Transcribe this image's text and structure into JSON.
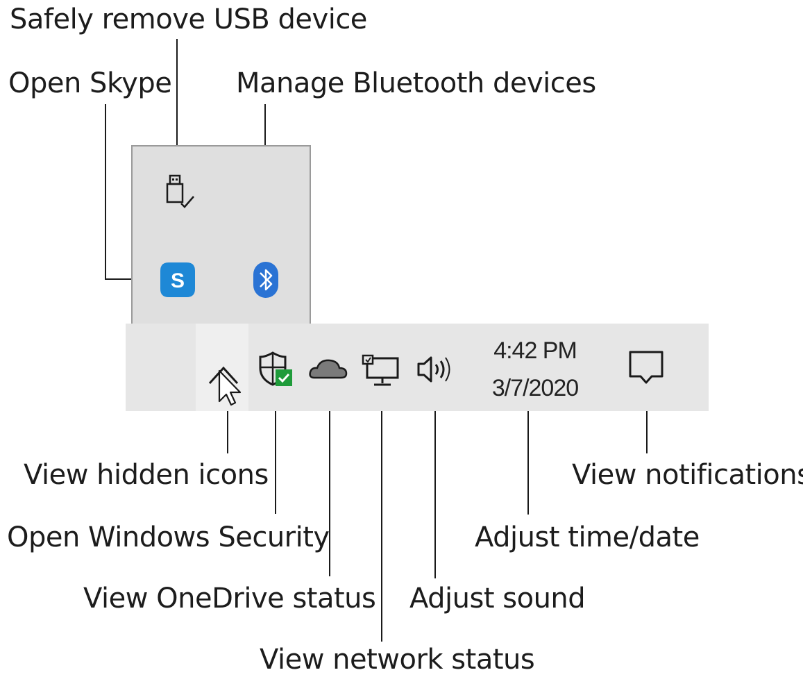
{
  "labels": {
    "safely_remove_usb": "Safely remove USB device",
    "open_skype": "Open Skype",
    "manage_bluetooth": "Manage Bluetooth devices",
    "view_hidden_icons": "View hidden icons",
    "open_windows_security": "Open Windows Security",
    "view_onedrive_status": "View OneDrive status",
    "view_network_status": "View network status",
    "adjust_sound": "Adjust sound",
    "adjust_time_date": "Adjust time/date",
    "view_notifications": "View notifications"
  },
  "taskbar": {
    "time": "4:42 PM",
    "date": "3/7/2020"
  },
  "tray_icons": [
    "chevron-up-icon",
    "windows-security-shield-icon",
    "onedrive-cloud-icon",
    "network-monitor-icon",
    "speaker-volume-icon",
    "notification-speech-bubble-icon"
  ],
  "overflow_icons": [
    "usb-drive-icon",
    "skype-icon",
    "bluetooth-icon"
  ],
  "colors": {
    "skype": "#1e88d6",
    "bluetooth": "#2a73d4",
    "security_check": "#1f9b3a",
    "taskbar": "#e6e6e6",
    "overflow_panel": "#dfdfdf"
  }
}
